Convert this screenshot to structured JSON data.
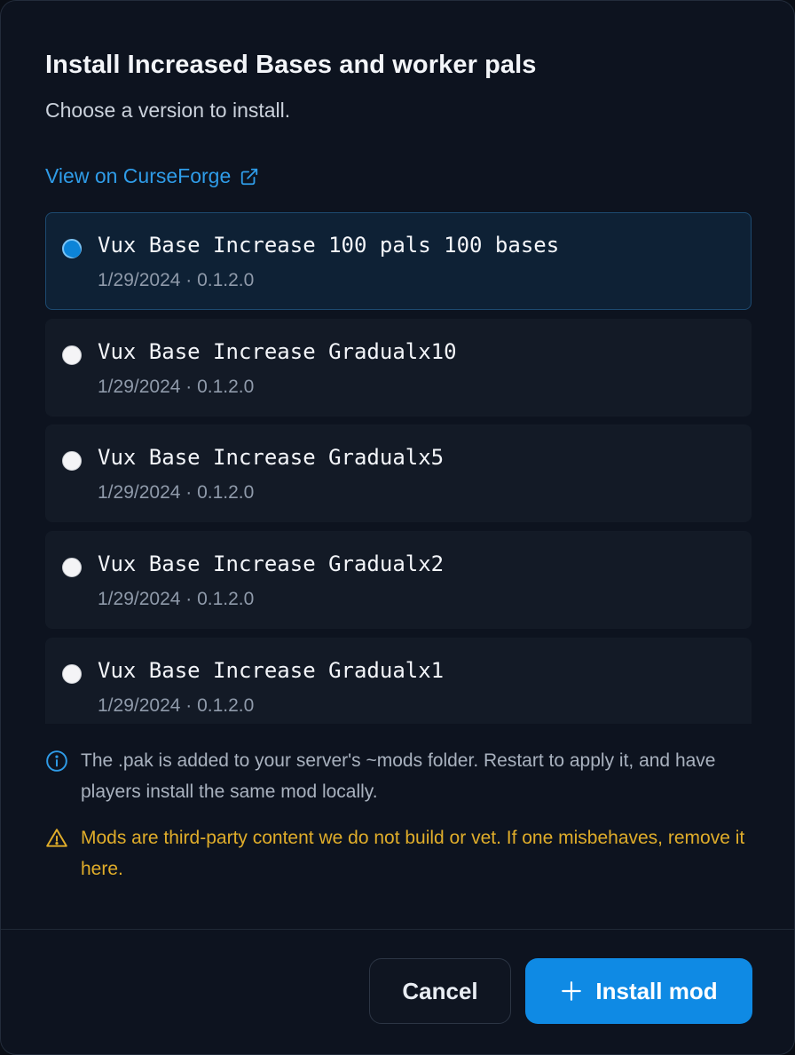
{
  "dialog": {
    "title": "Install Increased Bases and worker pals",
    "subtitle": "Choose a version to install.",
    "link_label": "View on CurseForge",
    "link_icon": "external-link-icon"
  },
  "options": [
    {
      "name": "Vux Base Increase 100 pals 100 bases",
      "meta": "1/29/2024 · 0.1.2.0",
      "selected": true
    },
    {
      "name": "Vux Base Increase Gradualx10",
      "meta": "1/29/2024 · 0.1.2.0",
      "selected": false
    },
    {
      "name": "Vux Base Increase Gradualx5",
      "meta": "1/29/2024 · 0.1.2.0",
      "selected": false
    },
    {
      "name": "Vux Base Increase Gradualx2",
      "meta": "1/29/2024 · 0.1.2.0",
      "selected": false
    },
    {
      "name": "Vux Base Increase Gradualx1",
      "meta": "1/29/2024 · 0.1.2.0",
      "selected": false
    }
  ],
  "notes": {
    "info": "The .pak is added to your server's ~mods folder. Restart to apply it, and have players install the same mod locally.",
    "warning": "Mods are third-party content we do not build or vet. If one misbehaves, remove it here."
  },
  "footer": {
    "cancel_label": "Cancel",
    "install_label": "Install mod"
  },
  "colors": {
    "accent": "#0f8ae4",
    "link": "#2f9ce8",
    "warning": "#e0ad2a",
    "background": "#0d131f"
  }
}
